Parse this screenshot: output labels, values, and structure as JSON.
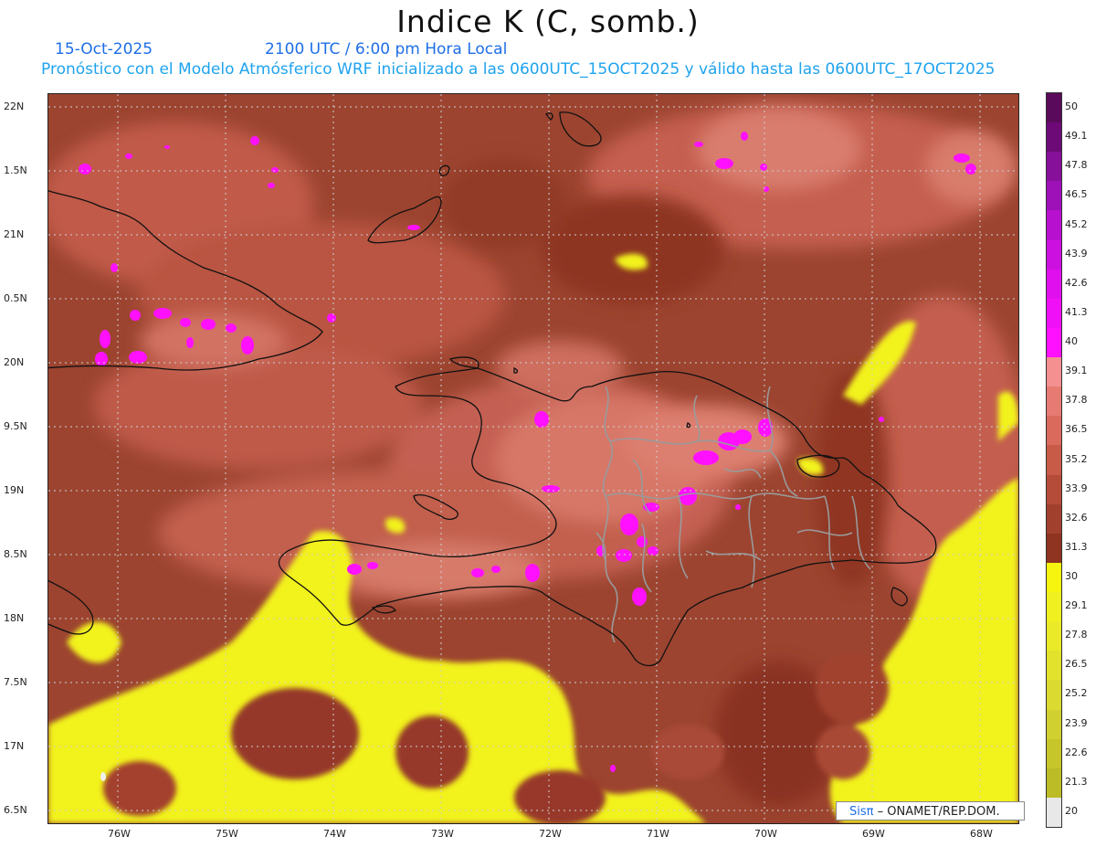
{
  "title": "Indice K (C, somb.)",
  "header": {
    "date": "15-Oct-2025",
    "time": "2100 UTC / 6:00 pm Hora Local",
    "description": "Pronóstico con el Modelo Atmósferico WRF inicializado a las 0600UTC_15OCT2025 y válido hasta las  0600UTC_17OCT2025"
  },
  "map": {
    "latitude_labels": [
      "22N",
      "1.5N",
      "21N",
      "0.5N",
      "20N",
      "9.5N",
      "19N",
      "8.5N",
      "18N",
      "7.5N",
      "17N",
      "6.5N"
    ],
    "longitude_labels": [
      "76W",
      "75W",
      "74W",
      "73W",
      "72W",
      "71W",
      "70W",
      "69W",
      "68W"
    ],
    "lat_range": [
      16.5,
      22
    ],
    "lon_range": [
      -76.6,
      -67.6
    ]
  },
  "colorbar": {
    "labels": [
      "50",
      "49.1",
      "47.8",
      "46.5",
      "45.2",
      "43.9",
      "42.6",
      "41.3",
      "40",
      "39.1",
      "37.8",
      "36.5",
      "35.2",
      "33.9",
      "32.6",
      "31.3",
      "30",
      "29.1",
      "27.8",
      "26.5",
      "25.2",
      "23.9",
      "22.6",
      "21.3",
      "20"
    ],
    "colors": [
      "#5a0a5a",
      "#6e0a78",
      "#86109a",
      "#9e10b8",
      "#b810cf",
      "#cc10e0",
      "#e010ee",
      "#f010f8",
      "#ff10ff",
      "#f49090",
      "#e77a72",
      "#d96a5c",
      "#c85a48",
      "#b54c3a",
      "#a2402e",
      "#8e3420",
      "#f5f510",
      "#f0f020",
      "#eaea28",
      "#e2e22c",
      "#dada30",
      "#d0d030",
      "#c6c62a",
      "#bcbc26",
      "#e8e8e8"
    ]
  },
  "credit": {
    "brand": "Sisπ",
    "text": "– ONAMET/REP.DOM."
  }
}
